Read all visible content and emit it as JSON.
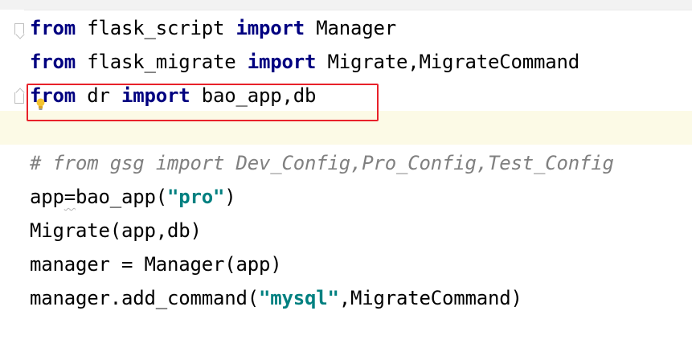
{
  "editor": {
    "lines": [
      {
        "parts": [
          {
            "t": "from",
            "c": "kw"
          },
          {
            "t": " flask_script ",
            "c": ""
          },
          {
            "t": "import",
            "c": "kw"
          },
          {
            "t": " Manager",
            "c": ""
          }
        ]
      },
      {
        "parts": [
          {
            "t": "from",
            "c": "kw"
          },
          {
            "t": " flask_migrate ",
            "c": ""
          },
          {
            "t": "import",
            "c": "kw"
          },
          {
            "t": " Migrate,",
            "c": ""
          },
          {
            "t": "MigrateCommand",
            "c": ""
          }
        ]
      },
      {
        "parts": [
          {
            "t": "from",
            "c": "kw"
          },
          {
            "t": " dr ",
            "c": ""
          },
          {
            "t": "import",
            "c": "kw"
          },
          {
            "t": " bao_app,",
            "c": ""
          },
          {
            "t": "db",
            "c": ""
          }
        ]
      },
      {
        "parts": []
      },
      {
        "parts": [
          {
            "t": "# from gsg import Dev_Config,Pro_Config,Test_Config",
            "c": "cm"
          }
        ]
      },
      {
        "parts": [
          {
            "t": "app",
            "c": ""
          },
          {
            "t": "=",
            "c": "wavy"
          },
          {
            "t": "bao_app(",
            "c": ""
          },
          {
            "t": "\"pro\"",
            "c": "str"
          },
          {
            "t": ")",
            "c": ""
          }
        ]
      },
      {
        "parts": [
          {
            "t": "Migrate(app,",
            "c": ""
          },
          {
            "t": "db)",
            "c": ""
          }
        ]
      },
      {
        "parts": [
          {
            "t": "manager = Manager(app)",
            "c": ""
          }
        ]
      },
      {
        "parts": [
          {
            "t": "manager.add_command(",
            "c": ""
          },
          {
            "t": "\"mysql\"",
            "c": "str"
          },
          {
            "t": ",",
            "c": ""
          },
          {
            "t": "MigrateCommand)",
            "c": ""
          }
        ]
      }
    ]
  },
  "gutter": {
    "fold_icon": "fold-marker-icon",
    "intention_icon": "lightbulb-icon"
  },
  "colors": {
    "keyword": "#000080",
    "string": "#008080",
    "comment": "#808080",
    "caret_line": "#fcfae6",
    "annotation_box": "#e8212a"
  }
}
